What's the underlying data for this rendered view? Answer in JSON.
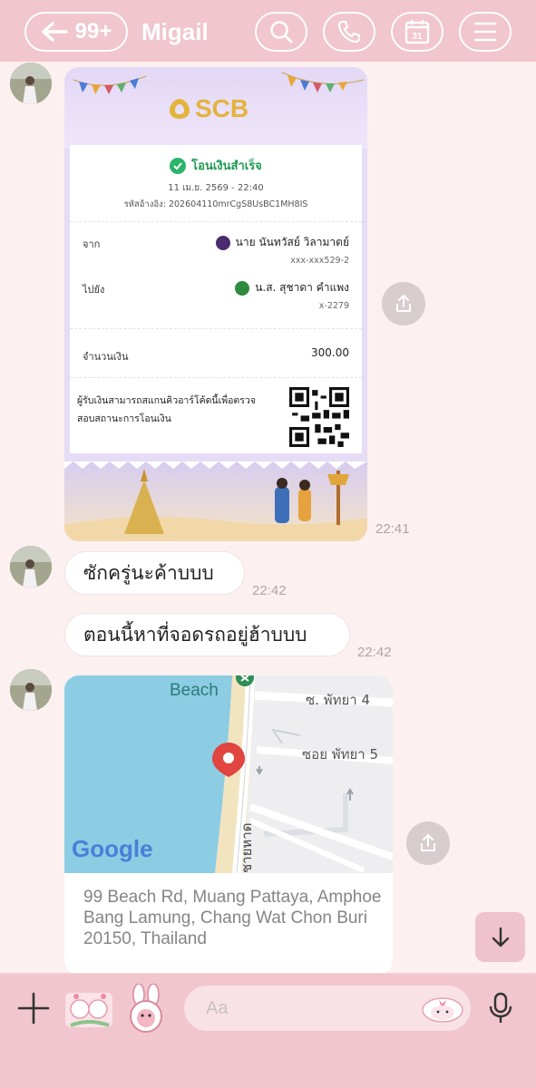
{
  "header": {
    "unread_count": "99+",
    "chat_name": "Migail",
    "calendar_day": "31"
  },
  "slip": {
    "bank_name": "SCB",
    "status": "โอนเงินสำเร็จ",
    "datetime": "11 เม.ย. 2569 - 22:40",
    "reference": "รหัสอ้างอิง: 202604110mrCgS8UsBC1MH8IS",
    "from_label": "จาก",
    "from_name": "นาย นันทวัสย์ วิลามาตย์",
    "from_account": "xxx-xxx529-2",
    "to_label": "ไปยัง",
    "to_name": "น.ส. สุชาดา คำแพง",
    "to_account": "x-2279",
    "amount_label": "จำนวนเงิน",
    "amount": "300.00",
    "qr_note": "ผู้รับเงินสามารถสแกนคิวอาร์โค้ดนี้เพื่อตรวจสอบสถานะการโอนเงิน"
  },
  "messages": {
    "slip_time": "22:41",
    "msg1_text": "ซักครู่นะค้าบบบ",
    "msg1_time": "22:42",
    "msg2_text": "ตอนนี้หาที่จอดรถอยู่ฮ้าบบบ",
    "msg2_time": "22:42"
  },
  "location": {
    "map_label_beach": "Beach",
    "map_label_road1": "ซ. พัทยา 4",
    "map_label_road2": "ซอย พัทยา 5",
    "map_label_road3": "ชายหาด",
    "map_brand": "Google",
    "address": "99 Beach Rd, Muang Pattaya, Amphoe Bang Lamung, Chang Wat Chon Buri 20150, Thailand"
  },
  "composer": {
    "placeholder": "Aa"
  },
  "colors": {
    "header_bg": "#f1c6ce",
    "chat_bg": "#fcf0f1",
    "success_green": "#1c9a53",
    "scb_gold": "#e3b33c"
  },
  "icons": [
    "back-arrow-icon",
    "search-icon",
    "phone-icon",
    "calendar-icon",
    "menu-icon",
    "share-icon",
    "location-pin-icon",
    "chevron-down-icon",
    "plus-icon",
    "microphone-icon"
  ]
}
